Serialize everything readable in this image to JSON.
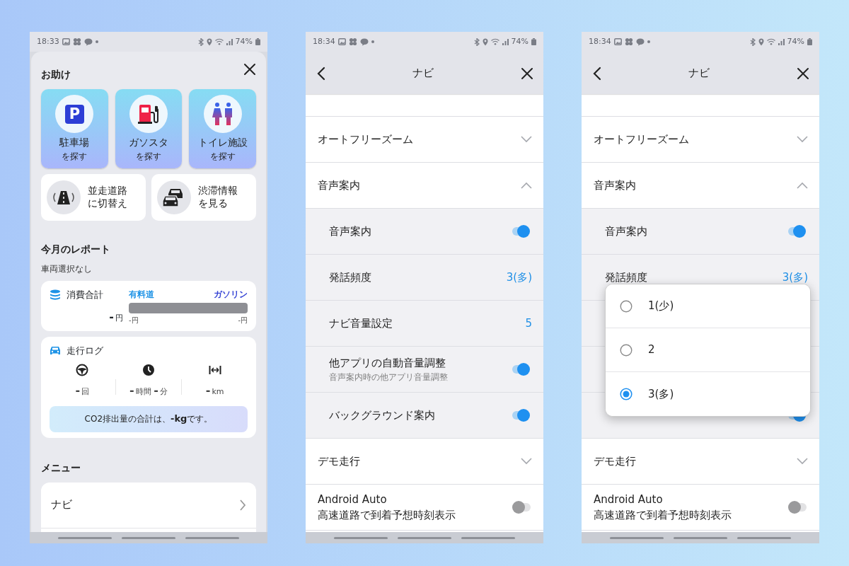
{
  "screens": [
    {
      "kind": "home",
      "status_bar": {
        "time": "18:33",
        "battery": "74%"
      },
      "help": {
        "title": "お助け",
        "tiles": [
          {
            "title": "駐車場",
            "subtitle": "を探す",
            "sign": "P"
          },
          {
            "title": "ガソスタ",
            "subtitle": "を探す"
          },
          {
            "title": "トイレ施設",
            "subtitle": "を探す"
          }
        ],
        "shortcuts": [
          {
            "title": "並走道路",
            "subtitle": "に切替え"
          },
          {
            "title": "渋滞情報",
            "subtitle": "を見る"
          }
        ]
      },
      "report": {
        "title": "今月のレポート",
        "vehicle": "車両選択なし",
        "consumption": {
          "title": "消費合計",
          "total": "**-**円",
          "toll_label": "有料道",
          "fuel_label": "ガソリン",
          "toll_value": "-円",
          "fuel_value": "-円"
        },
        "drive_log": {
          "title": "走行ログ",
          "stats": [
            "**-**回",
            "**-**時間 **-**分",
            "**-**km"
          ],
          "co2": "CO2排出量の合計は、**-kg**です。"
        }
      },
      "menu": {
        "title": "メニュー",
        "items": [
          {
            "label": "ナビ"
          }
        ]
      }
    },
    {
      "kind": "settings",
      "status_bar": {
        "time": "18:34",
        "battery": "74%"
      },
      "title": "ナビ",
      "rows": [
        {
          "kind": "section",
          "label": "オートフリーズーム",
          "expanded": false
        },
        {
          "kind": "section",
          "label": "音声案内",
          "expanded": true,
          "children": [
            {
              "kind": "toggle",
              "label": "音声案内",
              "on": true
            },
            {
              "kind": "value",
              "label": "発話頻度",
              "value": "3(多)"
            },
            {
              "kind": "value",
              "label": "ナビ音量設定",
              "value": "5"
            },
            {
              "kind": "toggle",
              "label": "他アプリの自動音量調整",
              "subtitle": "音声案内時の他アプリ音量調整",
              "on": true
            },
            {
              "kind": "toggle",
              "label": "バックグラウンド案内",
              "on": true
            }
          ]
        },
        {
          "kind": "section",
          "label": "デモ走行",
          "expanded": false
        },
        {
          "kind": "toggle",
          "label": "Android Auto",
          "second_line": "高速道路で到着予想時刻表示",
          "on": false
        }
      ]
    },
    {
      "kind": "settings",
      "status_bar": {
        "time": "18:34",
        "battery": "74%"
      },
      "title": "ナビ",
      "rows": [
        {
          "kind": "section",
          "label": "オートフリーズーム",
          "expanded": false
        },
        {
          "kind": "section",
          "label": "音声案内",
          "expanded": true,
          "children": [
            {
              "kind": "toggle",
              "label": "音声案内",
              "on": true
            },
            {
              "kind": "value",
              "label": "発話頻度",
              "value": "3(多)"
            },
            {
              "kind": "blank"
            },
            {
              "kind": "blank"
            },
            {
              "kind": "toggle",
              "on": true
            }
          ]
        },
        {
          "kind": "section",
          "label": "デモ走行",
          "expanded": false
        },
        {
          "kind": "toggle",
          "label": "Android Auto",
          "second_line": "高速道路で到着予想時刻表示",
          "on": false
        }
      ],
      "popup": {
        "options": [
          {
            "label": "1(少)",
            "selected": false
          },
          {
            "label": "2",
            "selected": false
          },
          {
            "label": "3(多)",
            "selected": true
          }
        ]
      }
    }
  ]
}
